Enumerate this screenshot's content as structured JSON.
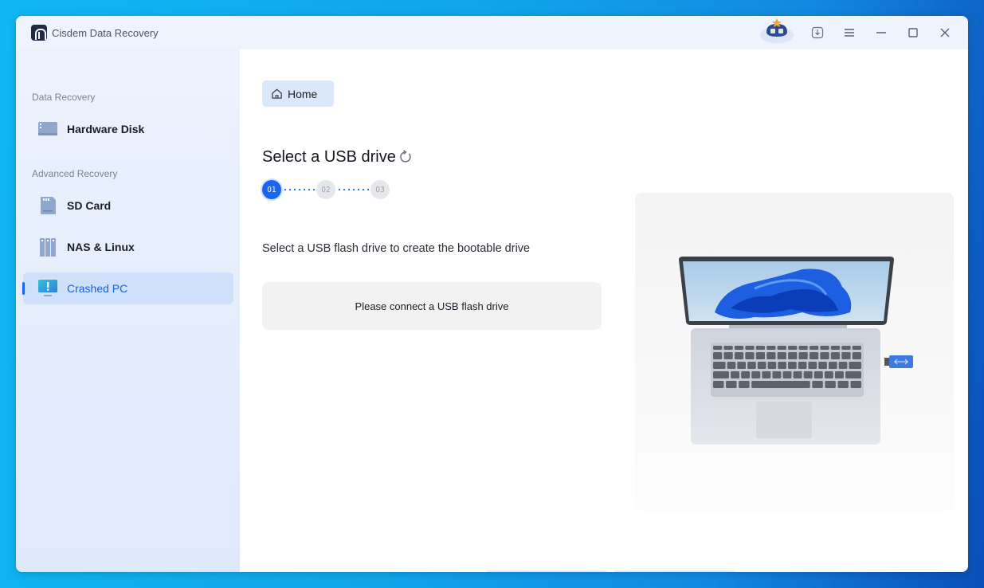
{
  "window": {
    "app_title": "Cisdem Data Recovery",
    "controls": {
      "mascot": "mascot-icon",
      "download": "download-icon",
      "menu": "menu-icon",
      "minimize": "minimize-icon",
      "maximize": "maximize-icon",
      "close": "close-icon"
    }
  },
  "sidebar": {
    "sections": [
      {
        "label": "Data Recovery",
        "items": [
          {
            "label": "Hardware Disk",
            "icon": "hard-disk-icon",
            "active": false
          }
        ]
      },
      {
        "label": "Advanced Recovery",
        "items": [
          {
            "label": "SD Card",
            "icon": "sd-card-icon",
            "active": false
          },
          {
            "label": "NAS & Linux",
            "icon": "nas-icon",
            "active": false
          },
          {
            "label": "Crashed PC",
            "icon": "crashed-pc-icon",
            "active": true
          }
        ]
      }
    ]
  },
  "main": {
    "breadcrumb": {
      "label": "Home",
      "icon": "home-icon"
    },
    "title": "Select a USB drive",
    "refresh_icon": "refresh-icon",
    "steps": [
      {
        "label": "01",
        "active": true
      },
      {
        "label": "02",
        "active": false
      },
      {
        "label": "03",
        "active": false
      }
    ],
    "description": "Select a USB flash drive to create the bootable drive",
    "usb_placeholder": "Please connect a USB flash drive",
    "illustration": "laptop-with-usb-illustration"
  },
  "colors": {
    "accent": "#1a66f0",
    "sidebar_bg": "#e6eefc",
    "active_item_bg": "#cfe0fb",
    "placeholder_bg": "#f2f2f3"
  }
}
